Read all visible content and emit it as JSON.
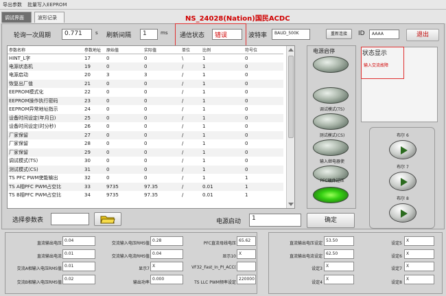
{
  "menu": [
    "导出参数",
    "批量写入EEPROM"
  ],
  "tabs": [
    {
      "label": "调试界面",
      "active": true
    },
    {
      "label": "波形记录",
      "active": false
    }
  ],
  "app_title": "NS_24028(Nation)国民ACDC",
  "toolbar": {
    "poll_label": "轮询一次周期",
    "poll_value": "0.771",
    "poll_unit": "s",
    "refresh_label": "刷新间隔",
    "refresh_value": "1",
    "refresh_unit": "ms",
    "comm_label": "通信状态",
    "comm_value": "错误",
    "baud_label": "波特率",
    "baud_value": "BAUD_500K",
    "reconnect_label": "重新连接",
    "id_label": "ID",
    "id_value": "AAAA",
    "exit_label": "退出"
  },
  "table": {
    "columns": [
      "参数名称",
      "参数地址",
      "原始值",
      "实际值",
      "单位",
      "比例",
      "符号位"
    ],
    "rows": [
      [
        "HINT_L字",
        "17",
        "0",
        "0",
        "\\",
        "1",
        "0"
      ],
      [
        "电源状态机",
        "19",
        "0",
        "0",
        "/",
        "1",
        "0"
      ],
      [
        "电源启动",
        "20",
        "3",
        "3",
        "/",
        "1",
        "0"
      ],
      [
        "恢复出厂值",
        "21",
        "0",
        "0",
        "/",
        "1",
        "0"
      ],
      [
        "EEPROM模式化",
        "22",
        "0",
        "0",
        "/",
        "1",
        "0"
      ],
      [
        "EEPROM操作执行密码",
        "23",
        "0",
        "0",
        "/",
        "1",
        "0"
      ],
      [
        "EEPROM异常地址指示",
        "24",
        "0",
        "0",
        "/",
        "1",
        "0"
      ],
      [
        "设备时间设定(年月日)",
        "25",
        "0",
        "0",
        "/",
        "1",
        "0"
      ],
      [
        "设备时间设定(时分秒)",
        "26",
        "0",
        "0",
        "/",
        "1",
        "0"
      ],
      [
        "厂家保留",
        "27",
        "0",
        "0",
        "/",
        "1",
        "0"
      ],
      [
        "厂家保留",
        "28",
        "0",
        "0",
        "/",
        "1",
        "0"
      ],
      [
        "厂家保留",
        "29",
        "0",
        "0",
        "/",
        "1",
        "0"
      ],
      [
        "调试模式(TS)",
        "30",
        "0",
        "0",
        "/",
        "1",
        "0"
      ],
      [
        "测试模式(CS)",
        "31",
        "0",
        "0",
        "/",
        "1",
        "0"
      ],
      [
        "TS PFC PWM使能输出",
        "32",
        "0",
        "0",
        "/",
        "1",
        "1"
      ],
      [
        "TS A相PFC PWM占空比",
        "33",
        "9735",
        "97.35",
        "/",
        "0.01",
        "1"
      ],
      [
        "TS B相PFC PWM占空比",
        "34",
        "9735",
        "97.35",
        "/",
        "0.01",
        "1"
      ]
    ]
  },
  "select_table_label": "选择参数表",
  "select_table_value": "",
  "power_start_label": "电源启动",
  "power_start_value": "1",
  "confirm_label": "确定",
  "power_panel": {
    "title": "电源启停",
    "buttons": [
      {
        "label": "",
        "on": false
      },
      {
        "label": "调试模式(TS)",
        "on": false
      },
      {
        "label": "测试模式(CS)",
        "on": false
      },
      {
        "label": "输入继电器使",
        "on": false
      },
      {
        "label": "PFC硬件过压",
        "on": true
      }
    ]
  },
  "status_panel": {
    "title": "状态显示",
    "message": "输入交流故障"
  },
  "bool_panel": {
    "items": [
      "布尔 6",
      "布尔 7",
      "布尔 8"
    ]
  },
  "bottom_left": [
    {
      "label": "直流输出电压",
      "value": "0.04"
    },
    {
      "label": "直流输出电流",
      "value": "0.01"
    },
    {
      "label": "交流A相输入电压RMS值",
      "value": "0.01"
    },
    {
      "label": "交流B相输入电压RMS值",
      "value": "0.02"
    },
    {
      "label": "交流输入电压RMS值",
      "value": "0.28"
    },
    {
      "label": "交流输入电流RMS值",
      "value": "0.04"
    },
    {
      "label": "显示7",
      "value": "X"
    },
    {
      "label": "输出功率",
      "value": "0.000"
    },
    {
      "label": "PFC直流母线电压",
      "value": "65.62"
    },
    {
      "label": "显示10",
      "value": "X"
    },
    {
      "label": "VF32_Fast_In_PI_ACC(",
      "value": ""
    },
    {
      "label": "TS LLC PWM频率设定",
      "value": "220000"
    }
  ],
  "bottom_right": [
    {
      "label": "直流输出电压设定",
      "value": "53.50"
    },
    {
      "label": "直流输出电流设定",
      "value": "62.50"
    },
    {
      "label": "设定3",
      "value": "X"
    },
    {
      "label": "设定4",
      "value": "X"
    },
    {
      "label": "设定5",
      "value": "X"
    },
    {
      "label": "设定6",
      "value": "X"
    },
    {
      "label": "设定7",
      "value": "X"
    },
    {
      "label": "设定8",
      "value": "X"
    }
  ]
}
